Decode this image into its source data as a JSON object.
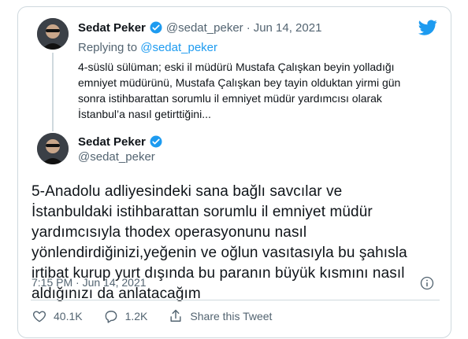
{
  "reply_tweet": {
    "display_name": "Sedat Peker",
    "handle": "@sedat_peker",
    "date": "Jun 14, 2021",
    "separator": "·",
    "replying_to_label": "Replying to",
    "replying_to_handle": "@sedat_peker",
    "text": "4-süslü sülüman; eski il müdürü Mustafa Çalışkan beyin yolladığı emniyet müdürünü, Mustafa Çalışkan bey tayin olduktan yirmi gün sonra istihbarattan sorumlu il emniyet müdür yardımcısı olarak İstanbul’a nasıl getirttiğini..."
  },
  "main_tweet": {
    "display_name": "Sedat Peker",
    "handle": "@sedat_peker",
    "text": "5-Anadolu adliyesindeki sana bağlı savcılar ve İstanbuldaki istihbarattan sorumlu il emniyet müdür yardımcısıyla thodex operasyonunu nasıl yönlendirdiğinizi,yeğenin ve oğlun vasıtasıyla bu şahısla irtibat kurup yurt dışında bu paranın büyük kısmını nasıl aldığınızı da anlatacağım",
    "timestamp": "7:15 PM · Jun 14, 2021"
  },
  "actions": {
    "likes": "40.1K",
    "replies": "1.2K",
    "share_label": "Share this Tweet"
  },
  "colors": {
    "brand_blue": "#1d9bf0",
    "verified_blue": "#1d9bf0",
    "text": "#0f1419",
    "muted": "#536471",
    "border": "#cfd9de"
  },
  "icons": [
    "twitter-bird-icon",
    "verified-badge-icon",
    "heart-icon",
    "reply-icon",
    "share-icon",
    "info-icon"
  ]
}
